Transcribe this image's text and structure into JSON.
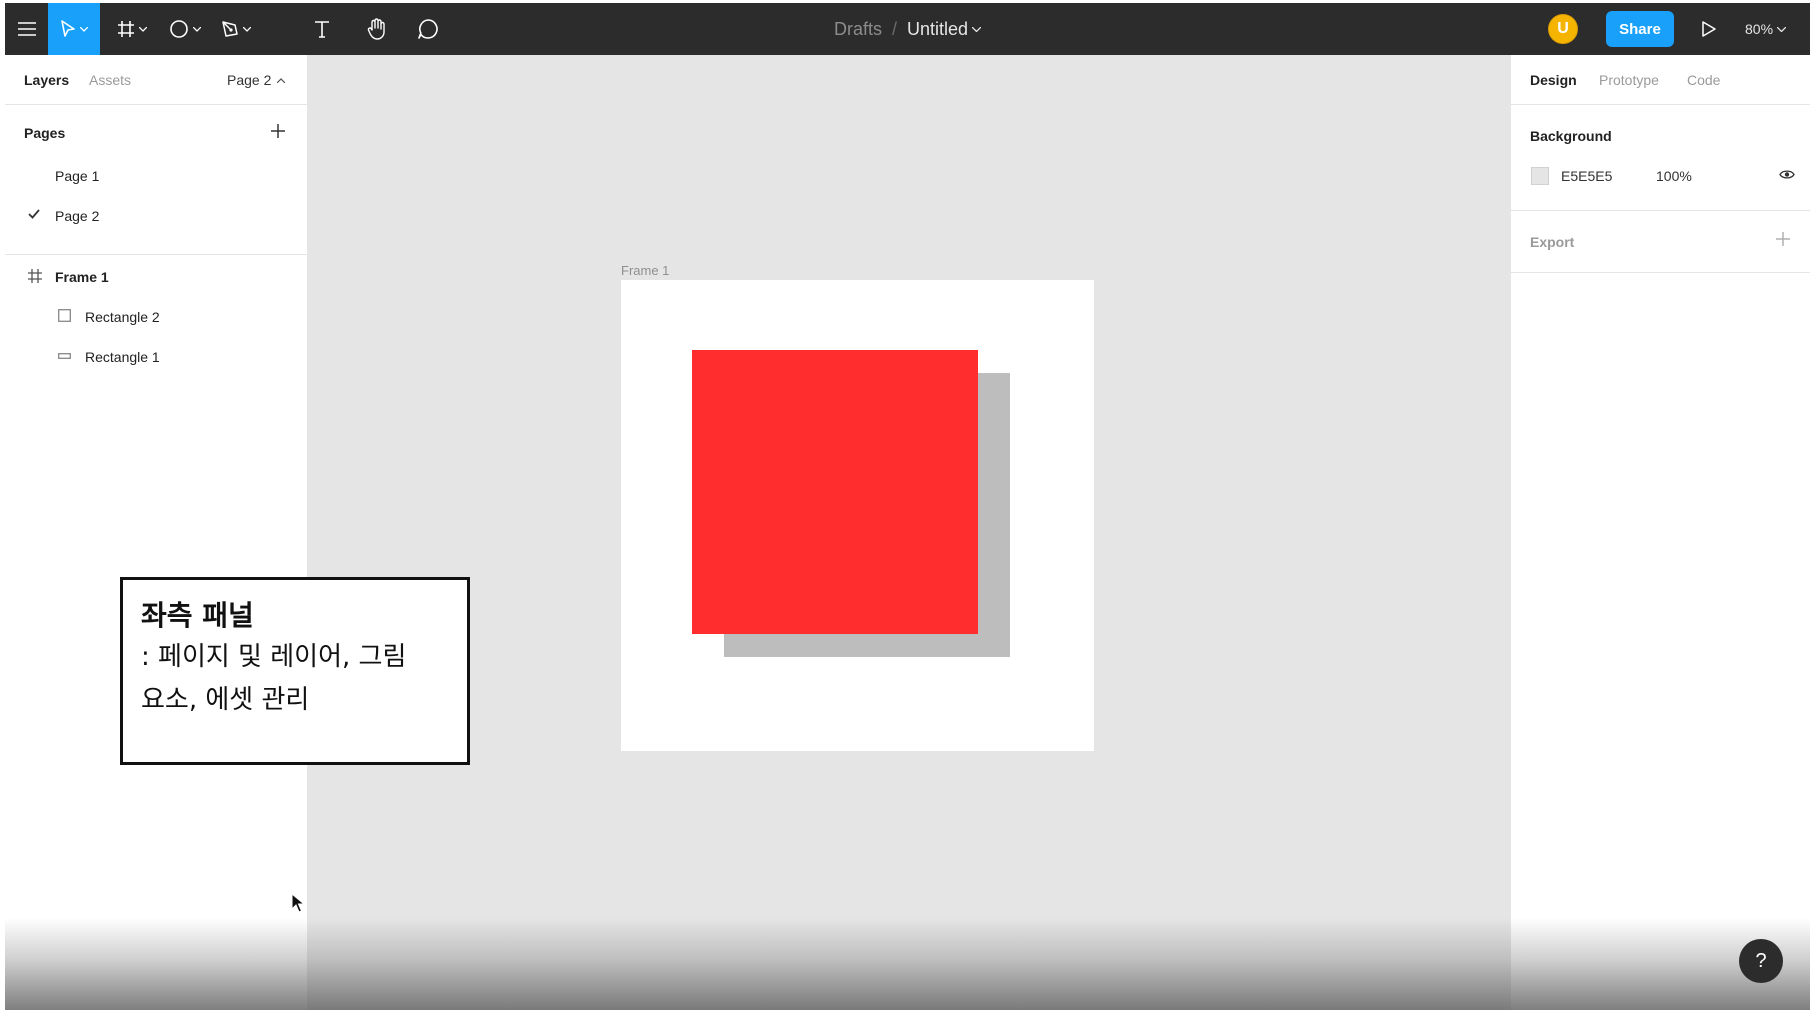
{
  "toolbar": {
    "breadcrumb_parent": "Drafts",
    "breadcrumb_sep": "/",
    "file_title": "Untitled",
    "avatar_initial": "U",
    "share_label": "Share",
    "zoom_level": "80%"
  },
  "left_panel": {
    "tabs": {
      "layers": "Layers",
      "assets": "Assets"
    },
    "current_page": "Page 2",
    "pages_heading": "Pages",
    "pages": [
      {
        "label": "Page 1",
        "selected": false
      },
      {
        "label": "Page 2",
        "selected": true
      }
    ],
    "layers": [
      {
        "label": "Frame 1",
        "type": "frame"
      },
      {
        "label": "Rectangle 2",
        "type": "rectangle"
      },
      {
        "label": "Rectangle 1",
        "type": "rectangle"
      }
    ]
  },
  "canvas": {
    "frame_label": "Frame 1",
    "frame_color": "#FFFFFF",
    "rect2_color": "#FF2D2D",
    "rect1_color": "#BDBDBD"
  },
  "right_panel": {
    "tabs": {
      "design": "Design",
      "prototype": "Prototype",
      "code": "Code"
    },
    "background_heading": "Background",
    "background_hex": "E5E5E5",
    "background_opacity": "100%",
    "export_label": "Export"
  },
  "caption": {
    "title": "좌측 패널",
    "line1": ": 페이지 및 레이어, 그림",
    "line2": "요소, 에셋 관리"
  },
  "help_label": "?",
  "colors": {
    "accent": "#18A0FB",
    "toolbar": "#2C2C2C",
    "avatar": "#F4B400"
  }
}
